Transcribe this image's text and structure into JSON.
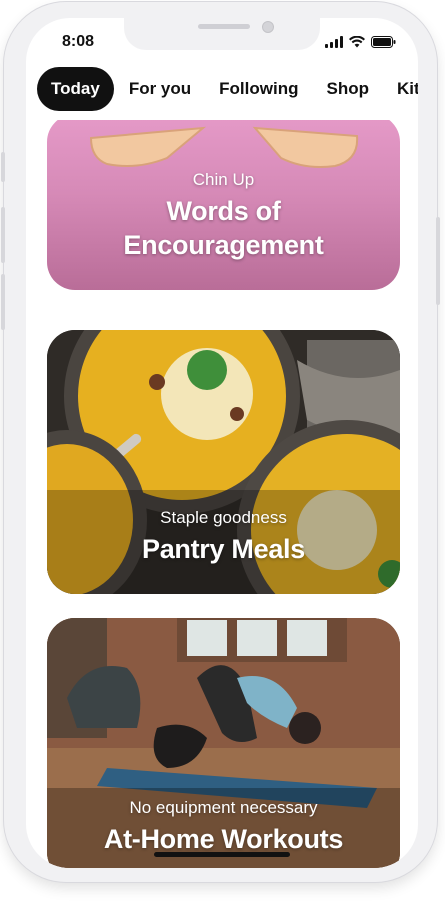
{
  "status": {
    "time": "8:08"
  },
  "tabs": [
    {
      "label": "Today",
      "active": true
    },
    {
      "label": "For you",
      "active": false
    },
    {
      "label": "Following",
      "active": false
    },
    {
      "label": "Shop",
      "active": false
    },
    {
      "label": "Kitchen",
      "active": false
    }
  ],
  "cards": [
    {
      "subtitle": "Chin Up",
      "title": "Words of Encouragement",
      "color": "#d68ab7"
    },
    {
      "subtitle": "Staple goodness",
      "title": "Pantry Meals",
      "color": "#3a352f"
    },
    {
      "subtitle": "No equipment necessary",
      "title": "At-Home Workouts",
      "color": "#6e5440"
    }
  ]
}
